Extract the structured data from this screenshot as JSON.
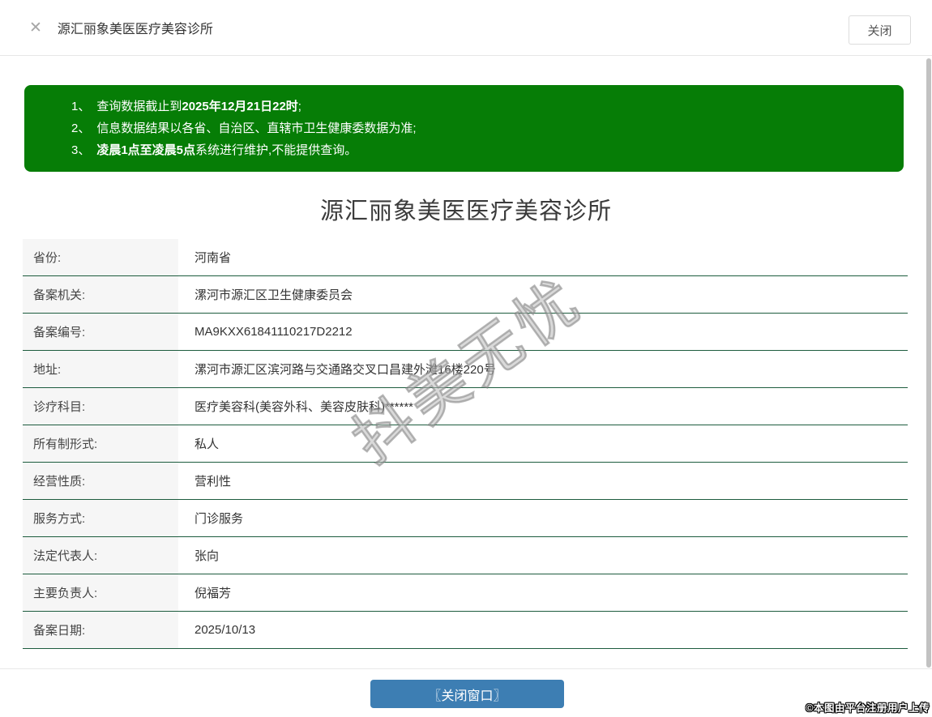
{
  "header": {
    "title": "源汇丽象美医医疗美容诊所",
    "close_button_label": "关闭"
  },
  "icons": {
    "close": "✕"
  },
  "colors": {
    "notice_green": "#067d06",
    "button_blue": "#3d7eb3",
    "table_border": "#1d5c3e"
  },
  "notice": {
    "items": [
      {
        "num": "1、",
        "segments": [
          {
            "text": "查询数据截止到",
            "bold": false
          },
          {
            "text": "2025年12月21日22时",
            "bold": true
          },
          {
            "text": ";",
            "bold": false
          }
        ]
      },
      {
        "num": "2、",
        "segments": [
          {
            "text": "信息数据结果以各省、自治区、直辖市卫生健康委数据为准;",
            "bold": false
          }
        ]
      },
      {
        "num": "3、",
        "segments": [
          {
            "text": "凌晨1点至凌晨5点",
            "bold": true
          },
          {
            "text": "系统进行维护,不能提供查询。",
            "bold": false
          }
        ]
      }
    ]
  },
  "main": {
    "title": "源汇丽象美医医疗美容诊所"
  },
  "table": {
    "rows": [
      {
        "label": "省份:",
        "value": "河南省"
      },
      {
        "label": "备案机关:",
        "value": "漯河市源汇区卫生健康委员会"
      },
      {
        "label": "备案编号:",
        "value": "MA9KXX61841110217D2212"
      },
      {
        "label": "地址:",
        "value": "漯河市源汇区滨河路与交通路交叉口昌建外滩16楼220号"
      },
      {
        "label": "诊疗科目:",
        "value": "医疗美容科(美容外科、美容皮肤科)******"
      },
      {
        "label": "所有制形式:",
        "value": "私人"
      },
      {
        "label": "经营性质:",
        "value": "营利性"
      },
      {
        "label": "服务方式:",
        "value": "门诊服务"
      },
      {
        "label": "法定代表人:",
        "value": "张向"
      },
      {
        "label": "主要负责人:",
        "value": "倪福芳"
      },
      {
        "label": "备案日期:",
        "value": "2025/10/13"
      }
    ]
  },
  "watermark": {
    "text": "抖美无忧"
  },
  "footer": {
    "close_button_label": "〖关闭窗口〗"
  },
  "attribution": "©本图由平台注册用户上传"
}
